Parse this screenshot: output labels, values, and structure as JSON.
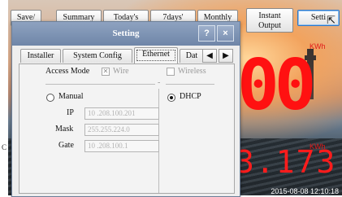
{
  "toolbar": {
    "buttons": [
      "Save/",
      "Summary",
      "Today's",
      "7days'",
      "Monthly",
      "Instant\nOutput",
      "Setti"
    ]
  },
  "display": {
    "kwh_unit": "KWh",
    "big_value": "00",
    "small_value": "3.173",
    "timestamp": "2015-08-08 12:10:18",
    "left_edge_char": "C"
  },
  "dialog": {
    "title": "Setting",
    "help_label": "?",
    "close_label": "×",
    "tabs": [
      "Installer",
      "System Config",
      "Ethernet",
      "Dat"
    ],
    "active_tab": "Ethernet",
    "access_mode": {
      "label": "Access Mode",
      "wire": "Wire",
      "wire_checked": true,
      "wireless": "Wireless",
      "wireless_checked": false,
      "separator": "-"
    },
    "manual": {
      "label": "Manual",
      "selected": false
    },
    "dhcp": {
      "label": "DHCP",
      "selected": true
    },
    "fields": {
      "ip_label": "IP",
      "ip_value": "10 .208.100.201",
      "mask_label": "Mask",
      "mask_value": "255.255.224.0",
      "gate_label": "Gate",
      "gate_value": "10 .208.100.1"
    }
  },
  "colors": {
    "accent_red": "#ff1111",
    "title_bar": "#7f94b5"
  }
}
